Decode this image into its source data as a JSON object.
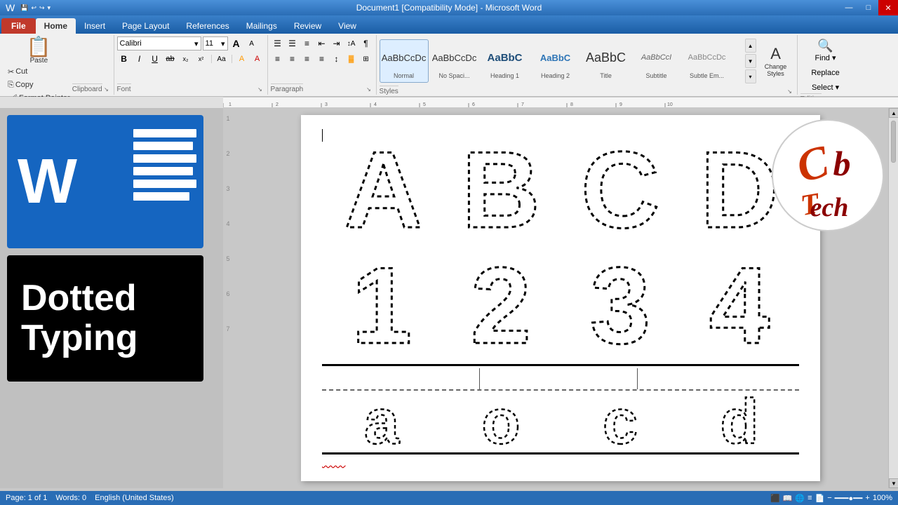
{
  "titlebar": {
    "title": "Document1 [Compatibility Mode] - Microsoft Word",
    "min_label": "—",
    "max_label": "□",
    "close_label": "✕"
  },
  "quickaccess": {
    "save_label": "💾",
    "undo_label": "↩",
    "redo_label": "↪",
    "dropdown_label": "▾"
  },
  "tabs": {
    "file": "File",
    "home": "Home",
    "insert": "Insert",
    "page_layout": "Page Layout",
    "references": "References",
    "mailings": "Mailings",
    "review": "Review",
    "view": "View"
  },
  "clipboard": {
    "paste_label": "Paste",
    "cut_label": "Cut",
    "copy_label": "Copy",
    "format_painter_label": "Format Painter",
    "group_label": "Clipboard"
  },
  "font": {
    "name": "Calibri",
    "size": "11",
    "bold": "B",
    "italic": "I",
    "underline": "U",
    "strikethrough": "ab",
    "subscript": "x₂",
    "superscript": "x²",
    "grow": "A",
    "shrink": "A",
    "change_case": "Aa",
    "clear_format": "⊘",
    "group_label": "Font"
  },
  "paragraph": {
    "bullets_label": "≡",
    "numbering_label": "≡#",
    "group_label": "Paragraph"
  },
  "styles": {
    "normal_label": "Normal",
    "normal_preview": "AaBbCcDc",
    "no_spacing_label": "No Spaci...",
    "no_spacing_preview": "AaBbCcDc",
    "heading1_label": "Heading 1",
    "heading1_preview": "AaBbC",
    "heading2_label": "Heading 2",
    "heading2_preview": "AaBbC",
    "title_label": "Title",
    "title_preview": "AaBbC",
    "subtitle_label": "Subtitle",
    "subtitle_preview": "AaBbCcI",
    "subtle_em_label": "Subtle Em...",
    "subtle_em_preview": "AaBbCcDc",
    "change_styles_label": "Change\nStyles",
    "group_label": "Styles"
  },
  "editing": {
    "group_label": "Editing"
  },
  "logo": {
    "word_letter": "W",
    "banner_line1": "Dotted",
    "banner_line2": "Typing",
    "cb_text": "Cb\nTech"
  },
  "document": {
    "letters_row1": [
      "A",
      "B",
      "C",
      "D"
    ],
    "letters_row2": [
      "1",
      "2",
      "3",
      "4"
    ],
    "letters_row3": [
      "a",
      "o",
      "c",
      "d"
    ]
  },
  "statusbar": {
    "page_info": "Page: 1 of 1",
    "words_info": "Words: 0",
    "language": "English (United States)"
  }
}
